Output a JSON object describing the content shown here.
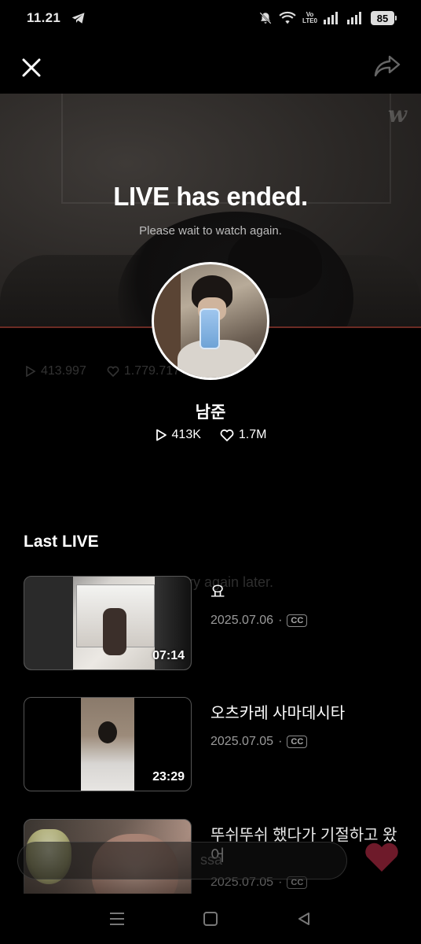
{
  "status_bar": {
    "time": "11.21",
    "volte_top": "Vo",
    "volte_bottom": "LTE0",
    "battery": "85"
  },
  "video": {
    "ended_title": "LIVE has ended.",
    "ended_subtitle": "Please wait to watch again.",
    "logo": "w"
  },
  "ghost": {
    "plays": "413.997",
    "likes": "1.779.717",
    "message": "ry again later.",
    "comment_placeholder": "ssa"
  },
  "profile": {
    "name": "남준",
    "plays": "413K",
    "likes": "1.7M"
  },
  "last_live": {
    "heading": "Last LIVE",
    "items": [
      {
        "title": "요",
        "date": "2025.07.06",
        "cc": "CC",
        "duration": "07:14"
      },
      {
        "title": "오츠카레 사마데시타",
        "date": "2025.07.05",
        "cc": "CC",
        "duration": "23:29"
      },
      {
        "title": "뚜쉬뚜쉬 했다가 기절하고 왔어",
        "date": "2025.07.05",
        "cc": "CC",
        "duration": ""
      }
    ]
  },
  "icons": {
    "close": "close-icon",
    "share": "share-icon",
    "play": "play-icon",
    "heart": "heart-icon"
  },
  "colors": {
    "heart_accent": "#7a1f2e",
    "video_border": "#6b2b24"
  }
}
